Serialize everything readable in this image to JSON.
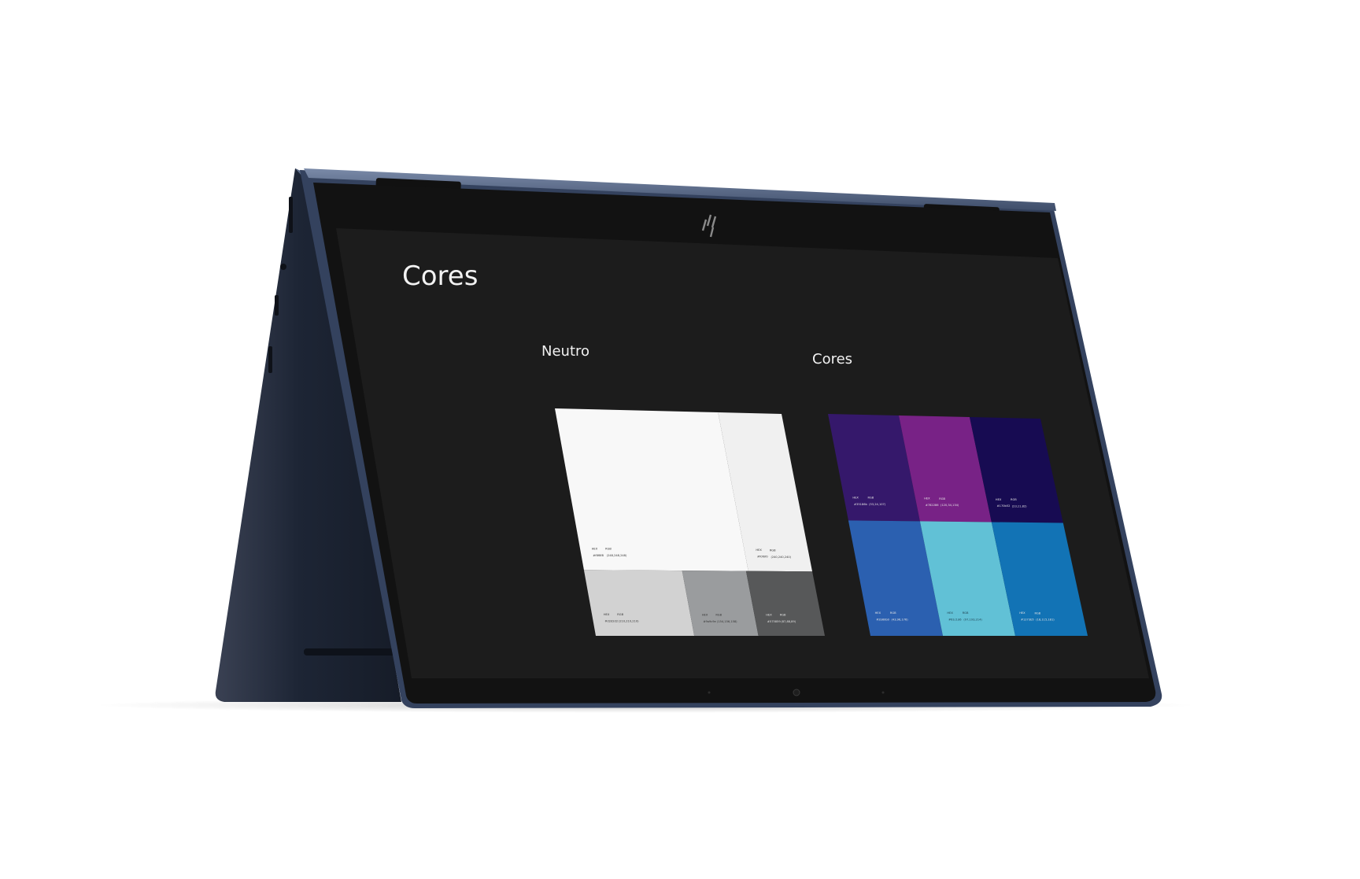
{
  "screen": {
    "page_title": "Cores",
    "neutral_section": {
      "heading": "Neutro"
    },
    "colors_section": {
      "heading": "Cores"
    }
  },
  "palette": {
    "neutral_swatches": [
      {
        "name": "neutral-white",
        "color": "#f8f8f8",
        "hex_label": "HEX",
        "rgb_label": "RGB",
        "hex": "#f8f8f8",
        "rgb": "(248,248,248)"
      },
      {
        "name": "neutral-light-gray",
        "color": "#f0f0f0",
        "hex_label": "HEX",
        "rgb_label": "RGB",
        "hex": "#f0f0f0",
        "rgb": "(240,240,240)"
      },
      {
        "name": "neutral-silver",
        "color": "#d2d2d2",
        "hex_label": "HEX",
        "rgb_label": "RGB",
        "hex": "#d2d2d2",
        "rgb": "(210,210,210)"
      },
      {
        "name": "neutral-gray",
        "color": "#9a9c9e",
        "hex_label": "HEX",
        "rgb_label": "RGB",
        "hex": "#9a9c9e",
        "rgb": "(154,156,158)"
      },
      {
        "name": "neutral-charcoal",
        "color": "#575859",
        "hex_label": "HEX",
        "rgb_label": "RGB",
        "hex": "#575859",
        "rgb": "(87,88,89)"
      }
    ],
    "color_swatches": [
      {
        "name": "deep-purple",
        "color": "#35186b",
        "hex_label": "HEX",
        "rgb_label": "RGB",
        "hex": "#35186b",
        "rgb": "(53,24,107)"
      },
      {
        "name": "magenta",
        "color": "#782286",
        "hex_label": "HEX",
        "rgb_label": "RGB",
        "hex": "#782286",
        "rgb": "(120,34,134)"
      },
      {
        "name": "midnight",
        "color": "#170b52",
        "hex_label": "HEX",
        "rgb_label": "RGB",
        "hex": "#170b52",
        "rgb": "(23,11,82)"
      },
      {
        "name": "royal-blue",
        "color": "#2b60b0",
        "hex_label": "HEX",
        "rgb_label": "RGB",
        "hex": "#2b60b0",
        "rgb": "(43,96,176)"
      },
      {
        "name": "sky-cyan",
        "color": "#61c1d6",
        "hex_label": "HEX",
        "rgb_label": "RGB",
        "hex": "#61c1d6",
        "rgb": "(97,193,214)"
      },
      {
        "name": "ocean-blue",
        "color": "#1273b5",
        "hex_label": "HEX",
        "rgb_label": "RGB",
        "hex": "#1273b5",
        "rgb": "(18,115,181)"
      }
    ]
  },
  "device_colors": {
    "body": "#1f2a3d",
    "bezel": "#121212",
    "screen_bg": "#1c1c1c",
    "hinge": "#4d5f7d"
  }
}
